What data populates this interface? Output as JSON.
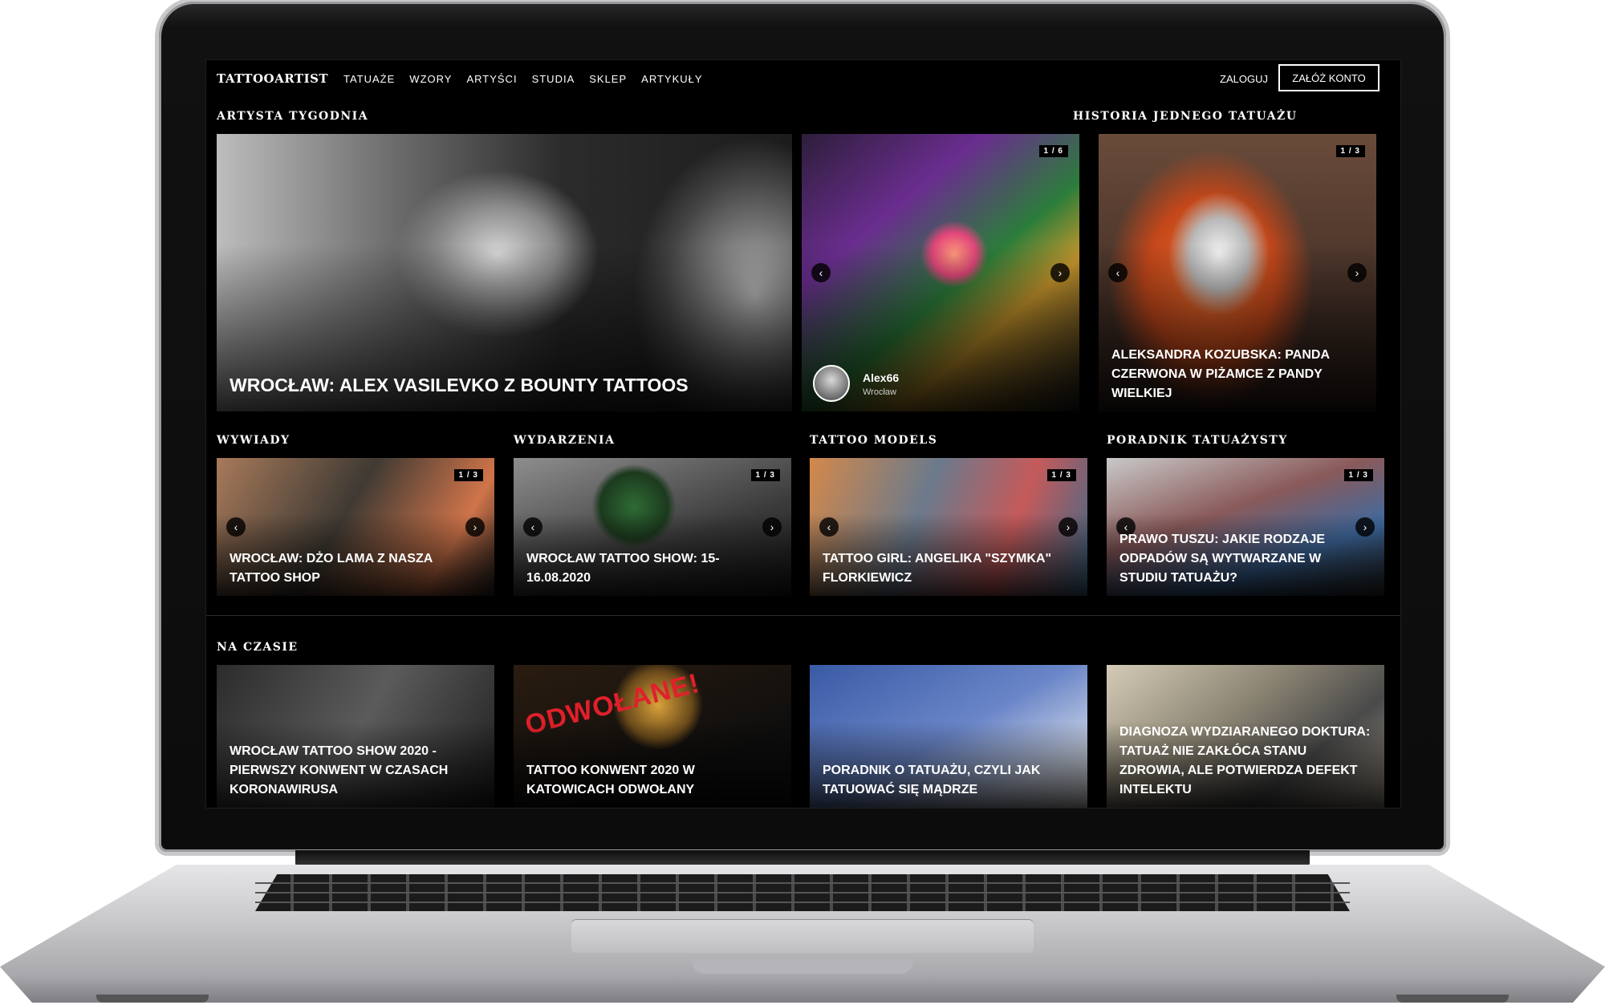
{
  "nav": {
    "logo": "TATTOOARTIST",
    "links": [
      "TATUAŻE",
      "WZORY",
      "ARTYŚCI",
      "STUDIA",
      "SKLEP",
      "ARTYKUŁY"
    ],
    "login": "ZALOGUJ",
    "register": "ZAŁÓŻ KONTO"
  },
  "sections": {
    "artist_of_week": "ARTYSTA TYGODNIA",
    "tattoo_story": "HISTORIA JEDNEGO TATUAŻU",
    "interviews": "WYWIADY",
    "events": "WYDARZENIA",
    "tattoo_models": "TATTOO MODELS",
    "guide": "PORADNIK TATUAŻYSTY",
    "trending": "NA CZASIE"
  },
  "featured": {
    "title": "WROCŁAW: ALEX VASILEVKO Z BOUNTY TATTOOS"
  },
  "gallery": {
    "counter": "1 / 6",
    "author_name": "Alex66",
    "author_city": "Wrocław"
  },
  "story": {
    "counter": "1 / 3",
    "title": "ALEKSANDRA KOZUBSKA: PANDA CZERWONA W PIŻAMCE Z PANDY WIELKIEJ"
  },
  "row2": [
    {
      "counter": "1 / 3",
      "title": "WROCŁAW: DŻO LAMA Z NASZA TATTOO SHOP"
    },
    {
      "counter": "1 / 3",
      "title": "WROCŁAW TATTOO SHOW: 15-16.08.2020"
    },
    {
      "counter": "1 / 3",
      "title": "TATTOO GIRL: ANGELIKA \"SZYMKA\" FLORKIEWICZ"
    },
    {
      "counter": "1 / 3",
      "title": "PRAWO TUSZU: JAKIE RODZAJE ODPADÓW SĄ WYTWARZANE W STUDIU TATUAŻU?"
    }
  ],
  "trending": [
    {
      "title": "WROCŁAW TATTOO SHOW 2020 - PIERWSZY KONWENT W CZASACH KORONAWIRUSA"
    },
    {
      "title": "TATTOO KONWENT 2020 W KATOWICACH ODWOŁANY",
      "stamp": "ODWOŁANE!"
    },
    {
      "title": "PORADNIK O TATUAŻU, CZYLI JAK TATUOWAĆ SIĘ MĄDRZE"
    },
    {
      "title": "DIAGNOZA WYDZIARANEGO DOKTURA: TATUAŻ NIE ZAKŁÓCA STANU ZDROWIA, ALE POTWIERDZA DEFEKT INTELEKTU"
    }
  ],
  "arrows": {
    "prev": "‹",
    "next": "›"
  }
}
